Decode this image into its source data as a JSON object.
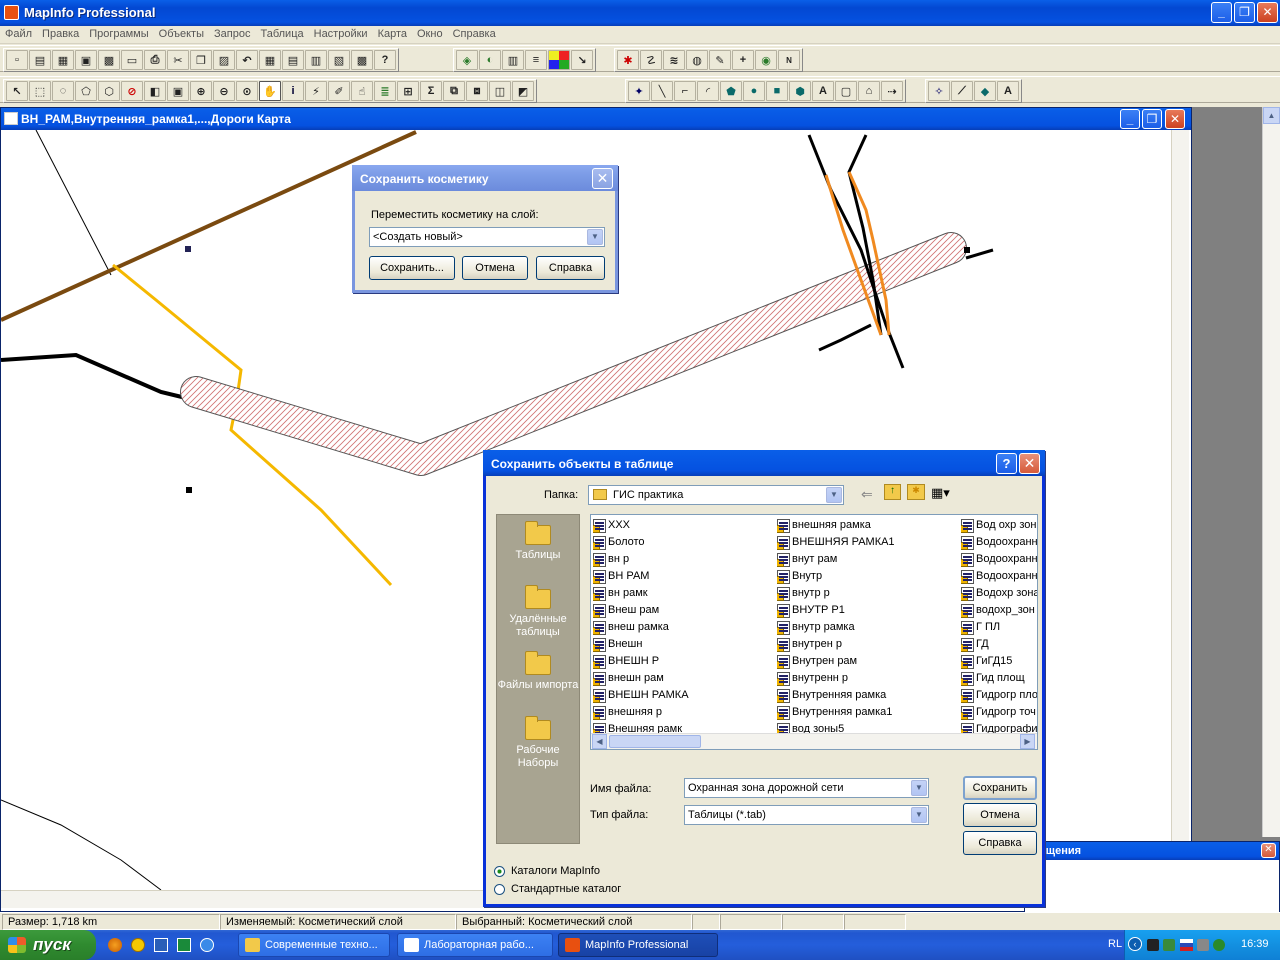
{
  "app": {
    "title": "MapInfo Professional",
    "controls": {
      "minimize": "_",
      "maximize": "❐",
      "close": "✕"
    }
  },
  "menu": [
    "Файл",
    "Правка",
    "Программы",
    "Объекты",
    "Запрос",
    "Таблица",
    "Настройки",
    "Карта",
    "Окно",
    "Справка"
  ],
  "map_window": {
    "title": "ВН_РАМ,Внутренняя_рамка1,...,Дороги Карта"
  },
  "cosmetic_dialog": {
    "title": "Сохранить косметику",
    "label": "Переместить косметику на слой:",
    "layer_value": "<Создать новый>",
    "btn_save": "Сохранить...",
    "btn_cancel": "Отмена",
    "btn_help": "Справка"
  },
  "save_dialog": {
    "title": "Сохранить объекты в таблице",
    "folder_label": "Папка:",
    "folder_value": "ГИС практика",
    "places": [
      {
        "label": "Таблицы"
      },
      {
        "label": "Удалённые таблицы"
      },
      {
        "label": "Файлы импорта"
      },
      {
        "label": "Рабочие Наборы"
      }
    ],
    "files_col1": [
      "XXX",
      "Болото",
      "вн р",
      "ВН РАМ",
      "вн рамк",
      "Внеш рам",
      "внеш рамка",
      "Внешн",
      "ВНЕШН Р",
      "внешн рам",
      "ВНЕШН РАМКА",
      "внешняя р",
      "Внешняя рамк"
    ],
    "files_col2": [
      "внешняя рамка",
      "ВНЕШНЯЯ РАМКА1",
      "внут рам",
      "Внутр",
      "внутр р",
      "ВНУТР Р1",
      "внутр рамка",
      "внутрен р",
      "Внутрен рам",
      "внутренн р",
      "Внутренняя рамка",
      "Внутренняя рамка1",
      "вод зоны5"
    ],
    "files_col3": [
      "Вод охр зоны",
      "Водоохранн",
      "Водоохранн",
      "Водоохранн",
      "Водохр зона",
      "водохр_зон",
      "Г ПЛ",
      "ГД",
      "ГиГД15",
      "Гид площ",
      "Гидрогр пло",
      "Гидрогр точ",
      "Гидрографи"
    ],
    "filename_label": "Имя файла:",
    "filename_value": "Охранная зона дорожной сети",
    "filetype_label": "Тип файла:",
    "filetype_value": "Таблицы (*.tab)",
    "btn_save": "Сохранить",
    "btn_cancel": "Отмена",
    "btn_help": "Справка",
    "radio1": "Каталоги MapInfo",
    "radio2": "Стандартные каталог"
  },
  "messages_window": {
    "title": "бщения"
  },
  "status": {
    "size": "Размер: 1,718 km",
    "editable": "Изменяемый: Косметический слой",
    "selected": "Выбранный: Косметический слой"
  },
  "taskbar": {
    "start": "пуск",
    "tasks": [
      "Современные техно...",
      "Лабораторная рабо...",
      "MapInfo Professional"
    ],
    "lang": "RL",
    "clock": "16:39"
  },
  "toolbar_icons": {
    "row1": [
      "new-icon",
      "open-icon",
      "open-workspace-icon",
      "save-icon",
      "save-workspace-icon",
      "print-setup-icon",
      "print-icon",
      "cut-icon",
      "copy-icon",
      "paste-icon",
      "undo-icon",
      "new-browser-icon",
      "new-mapper-icon",
      "new-grapher-icon",
      "new-layout-icon",
      "new-redistrict-icon",
      "help-icon",
      "layer-control-icon",
      "legend-icon",
      "statistics-icon",
      "info-icon",
      "theme-icon",
      "layout-icon",
      "tool-a-icon",
      "tool-b-icon",
      "tool-c-icon",
      "tool-d-icon",
      "tool-e-icon",
      "tool-f-icon",
      "tool-g-icon",
      "tool-h-icon"
    ],
    "row2": [
      "select-icon",
      "marquee-select-icon",
      "radius-select-icon",
      "polygon-select-icon",
      "boundary-select-icon",
      "unselect-icon",
      "invert-select-icon",
      "graph-select-icon",
      "zoom-in-icon",
      "zoom-out-icon",
      "change-view-icon",
      "grabber-icon",
      "info-tool-icon",
      "hotlink-icon",
      "label-icon",
      "drag-window-icon",
      "layer-icon",
      "ruler-icon",
      "sum-icon",
      "clip-icon",
      "set-target-icon",
      "combine-icon",
      "reshape-icon",
      "symbol-icon",
      "line-icon",
      "polyline-icon",
      "arc-icon",
      "polygon-icon",
      "ellipse-icon",
      "rectangle-icon",
      "rounded-rect-icon",
      "text-icon",
      "frame-icon",
      "add-node-icon",
      "node-icon",
      "line-style-icon",
      "region-style-icon",
      "text-style-icon",
      "style-a-icon"
    ]
  }
}
